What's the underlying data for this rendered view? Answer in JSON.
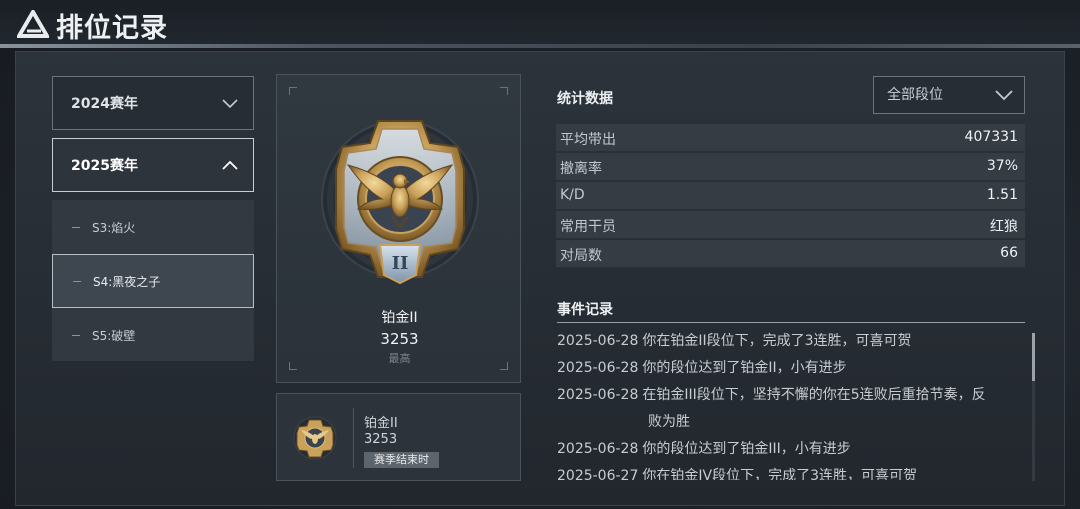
{
  "header": {
    "title": "排位记录"
  },
  "years": [
    {
      "label": "2024赛年",
      "expanded": false
    },
    {
      "label": "2025赛年",
      "expanded": true
    }
  ],
  "seasons": [
    {
      "label": "S3:焰火"
    },
    {
      "label": "S4:黑夜之子",
      "selected": true
    },
    {
      "label": "S5:破壁"
    }
  ],
  "current_rank": {
    "name": "铂金II",
    "score": "3253",
    "note": "最高"
  },
  "season_end": {
    "name": "铂金II",
    "score": "3253",
    "badge": "赛季结束时"
  },
  "stats": {
    "title": "统计数据",
    "filter": "全部段位",
    "rows": [
      {
        "label": "平均带出",
        "value": "407331"
      },
      {
        "label": "撤离率",
        "value": "37%"
      },
      {
        "label": "K/D",
        "value": "1.51"
      },
      {
        "label": "常用干员",
        "value": "红狼"
      },
      {
        "label": "对局数",
        "value": "66"
      }
    ]
  },
  "events": {
    "title": "事件记录",
    "items": [
      {
        "date": "2025-06-28",
        "text": "你在铂金II段位下，完成了3连胜，可喜可贺"
      },
      {
        "date": "2025-06-28",
        "text": "你的段位达到了铂金II，小有进步"
      },
      {
        "date": "2025-06-28",
        "text": "在铂金III段位下，坚持不懈的你在5连败后重拾节奏，反",
        "cont": "败为胜"
      },
      {
        "date": "2025-06-28",
        "text": "你的段位达到了铂金III，小有进步"
      },
      {
        "date": "2025-06-27",
        "text": "你在铂金IV段位下，完成了3连胜，可喜可贺"
      }
    ]
  },
  "colors": {
    "gold": "#c9a15a",
    "accent": "#b8c6d6"
  }
}
